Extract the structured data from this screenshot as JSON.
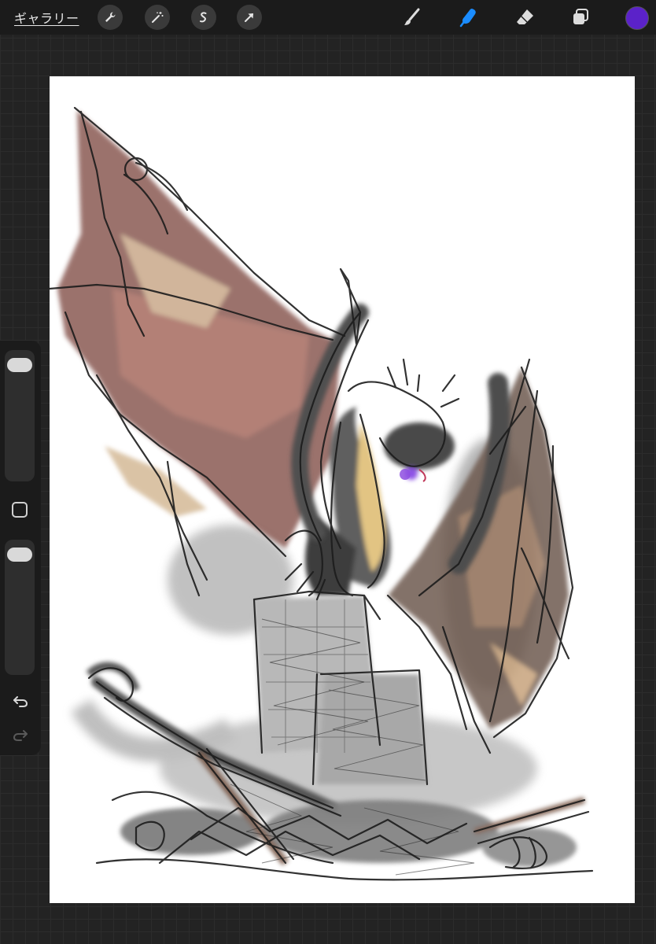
{
  "topbar": {
    "gallery_label": "ギャラリー",
    "left_tools": [
      "wrench-icon",
      "magic-wand-icon",
      "selection-icon",
      "transform-arrow-icon"
    ],
    "right_tools": [
      "brush-icon",
      "smudge-icon",
      "eraser-icon",
      "layers-icon"
    ],
    "active_tool": "smudge-icon",
    "current_color": "#5b22c9",
    "accent_color": "#1a8cff"
  },
  "sidebar": {
    "brush_size": 0.95,
    "opacity": 0.95,
    "icons": [
      "modify-square-icon",
      "undo-icon",
      "redo-icon"
    ]
  },
  "canvas": {
    "content": "dragon-sketch-artwork"
  }
}
